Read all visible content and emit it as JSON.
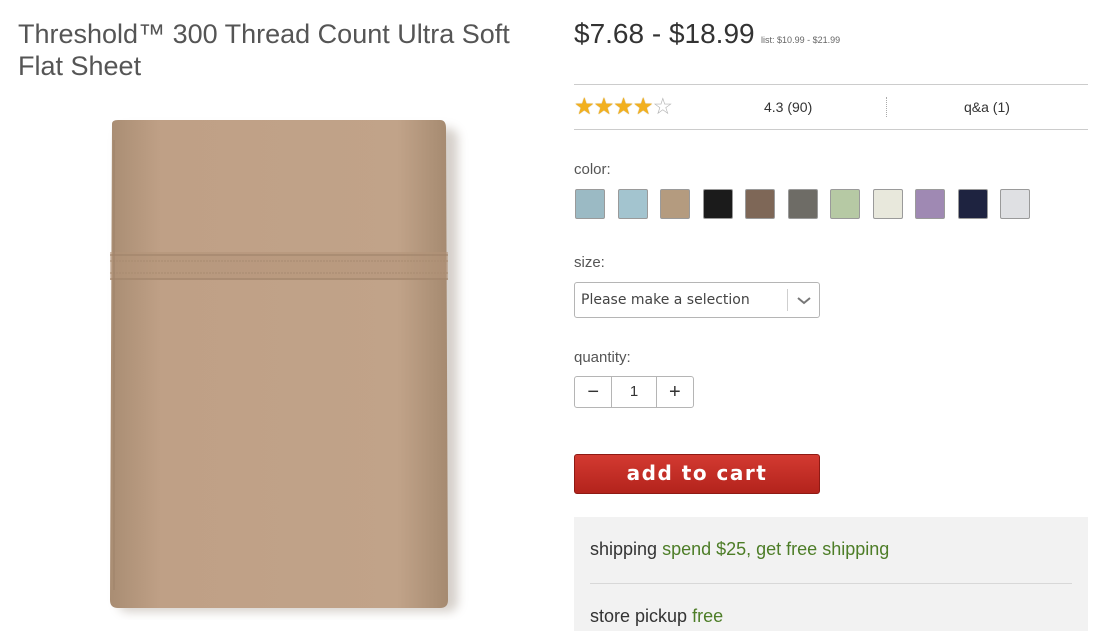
{
  "product": {
    "title": "Threshold™ 300 Thread Count Ultra Soft Flat Sheet",
    "image_color": "#bfa086"
  },
  "price": {
    "range": "$7.68 - $18.99",
    "list": "list: $10.99 - $21.99"
  },
  "rating": {
    "stars": 4,
    "max_stars": 5,
    "text": "4.3 (90)",
    "qa_label": "q&a (1)"
  },
  "color": {
    "label": "color:",
    "swatches": [
      "#9bbac4",
      "#a3c4cf",
      "#b49b7f",
      "#1b1b1b",
      "#7e6757",
      "#6e6c66",
      "#b6c9a4",
      "#e8e8dc",
      "#9f89b3",
      "#1e2340",
      "#dfe0e3"
    ]
  },
  "size": {
    "label": "size:",
    "placeholder": "Please make a selection"
  },
  "quantity": {
    "label": "quantity:",
    "value": "1",
    "minus": "−",
    "plus": "+"
  },
  "cart": {
    "button_label": "add to cart"
  },
  "fulfillment": {
    "shipping_label": "shipping",
    "shipping_offer": "spend $25, get free shipping",
    "pickup_label": "store pickup",
    "pickup_value": "free"
  }
}
